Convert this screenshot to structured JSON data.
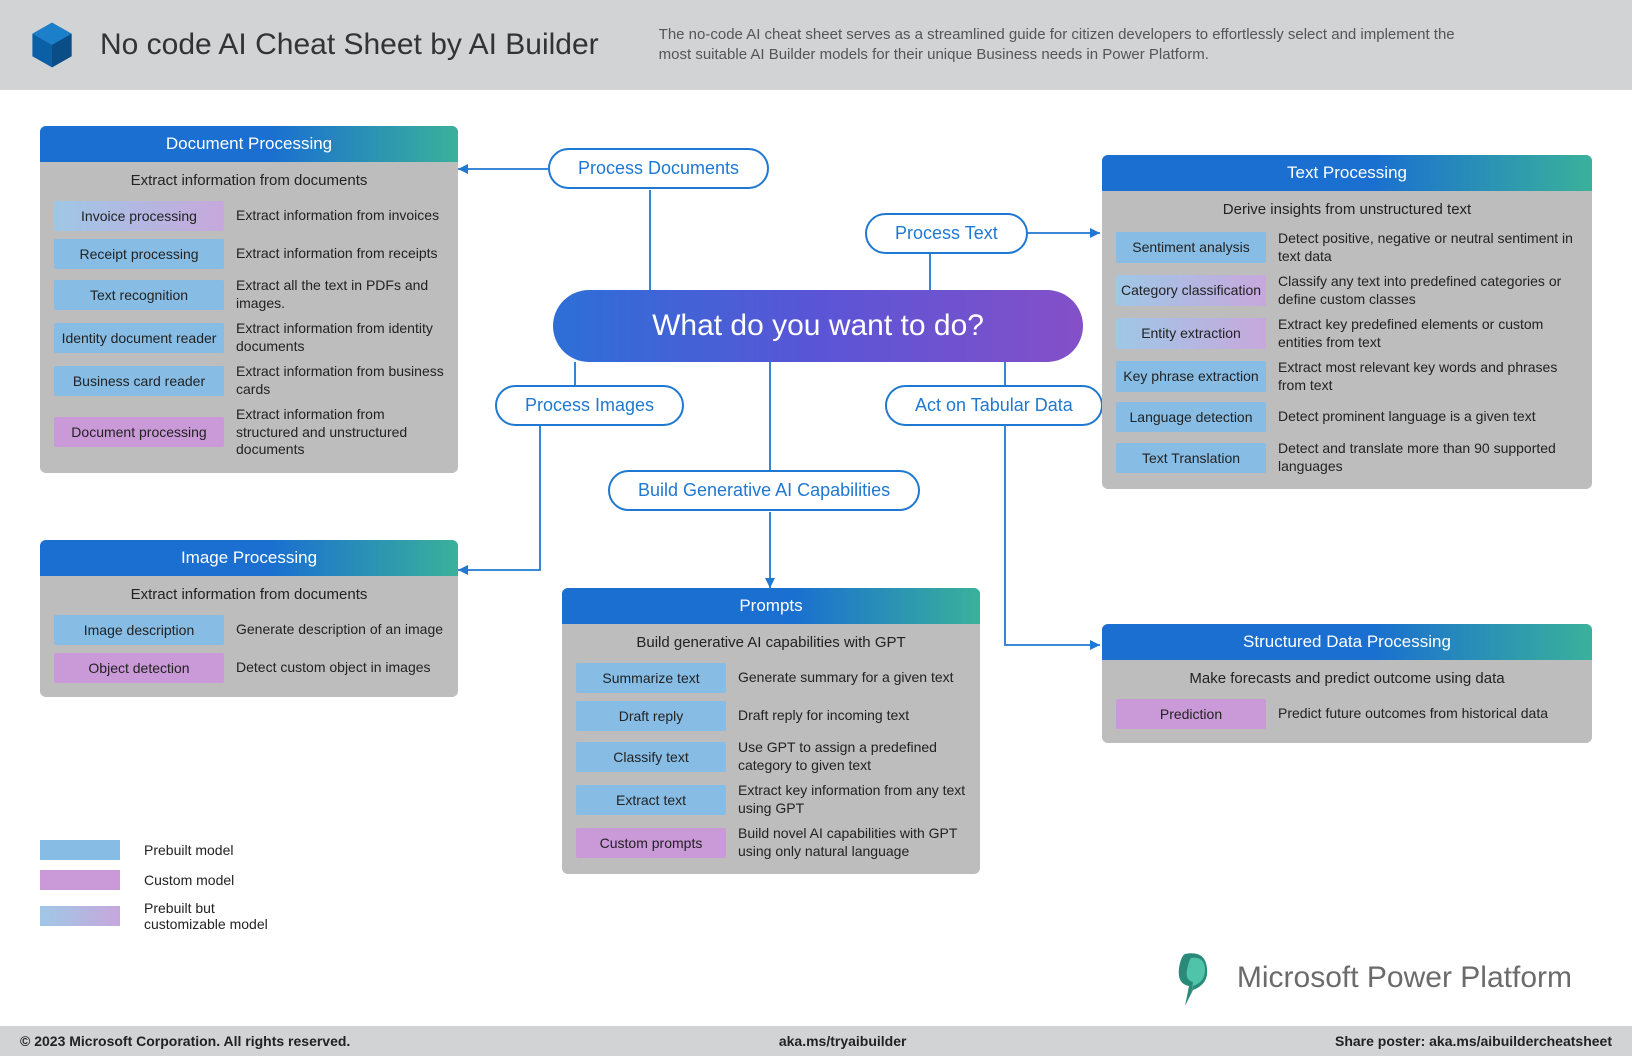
{
  "header": {
    "title": "No code AI Cheat Sheet by AI Builder",
    "subtitle": "The no-code AI cheat sheet serves as a streamlined guide for citizen developers to effortlessly select and implement the most suitable AI Builder models for their unique Business needs in Power Platform."
  },
  "center": "What do you want to do?",
  "branches": {
    "process_documents": "Process Documents",
    "process_images": "Process Images",
    "build_gen_ai": "Build Generative AI Capabilities",
    "process_text": "Process Text",
    "act_tabular": "Act on Tabular Data"
  },
  "doc_processing": {
    "header": "Document Processing",
    "sub": "Extract information from documents",
    "items": [
      {
        "name": "Invoice processing",
        "desc": "Extract information from invoices",
        "type": "grad"
      },
      {
        "name": "Receipt processing",
        "desc": "Extract information from receipts",
        "type": "blue"
      },
      {
        "name": "Text  recognition",
        "desc": "Extract all the text in PDFs and images.",
        "type": "blue"
      },
      {
        "name": "Identity document reader",
        "desc": "Extract information from identity documents",
        "type": "blue"
      },
      {
        "name": "Business card reader",
        "desc": "Extract information from business cards",
        "type": "blue"
      },
      {
        "name": "Document processing",
        "desc": "Extract information from structured and unstructured documents",
        "type": "pink"
      }
    ]
  },
  "image_processing": {
    "header": "Image Processing",
    "sub": "Extract information from documents",
    "items": [
      {
        "name": "Image description",
        "desc": "Generate description of an image",
        "type": "blue"
      },
      {
        "name": "Object detection",
        "desc": "Detect custom object in images",
        "type": "pink"
      }
    ]
  },
  "prompts": {
    "header": "Prompts",
    "sub": "Build generative AI capabilities with GPT",
    "items": [
      {
        "name": "Summarize text",
        "desc": "Generate summary for a given text",
        "type": "blue"
      },
      {
        "name": "Draft reply",
        "desc": "Draft reply for incoming text",
        "type": "blue"
      },
      {
        "name": "Classify text",
        "desc": "Use GPT to assign a predefined category to given text",
        "type": "blue"
      },
      {
        "name": "Extract text",
        "desc": "Extract key information from any text using GPT",
        "type": "blue"
      },
      {
        "name": "Custom prompts",
        "desc": "Build novel AI capabilities with GPT using only natural language",
        "type": "pink"
      }
    ]
  },
  "text_processing": {
    "header": "Text Processing",
    "sub": "Derive insights from unstructured text",
    "items": [
      {
        "name": "Sentiment analysis",
        "desc": "Detect positive, negative or neutral sentiment in text data",
        "type": "blue"
      },
      {
        "name": "Category classification",
        "desc": "Classify any text into predefined categories or define custom classes",
        "type": "grad"
      },
      {
        "name": "Entity extraction",
        "desc": "Extract key predefined elements or custom entities from text",
        "type": "grad"
      },
      {
        "name": "Key phrase extraction",
        "desc": "Extract most relevant key words and phrases from text",
        "type": "blue"
      },
      {
        "name": "Language detection",
        "desc": "Detect prominent language is a given text",
        "type": "blue"
      },
      {
        "name": "Text Translation",
        "desc": "Detect and translate more than 90 supported languages",
        "type": "blue"
      }
    ]
  },
  "structured_data": {
    "header": "Structured Data Processing",
    "sub": "Make forecasts and predict outcome using data",
    "items": [
      {
        "name": "Prediction",
        "desc": "Predict future outcomes from historical data",
        "type": "pink"
      }
    ]
  },
  "legend": {
    "prebuilt": "Prebuilt model",
    "custom": "Custom model",
    "hybrid": "Prebuilt but customizable model"
  },
  "product_name": "Microsoft Power Platform",
  "footer": {
    "copyright": "© 2023 Microsoft Corporation. All rights reserved.",
    "try": "aka.ms/tryaibuilder",
    "share": "Share poster: aka.ms/aibuildercheatsheet"
  }
}
